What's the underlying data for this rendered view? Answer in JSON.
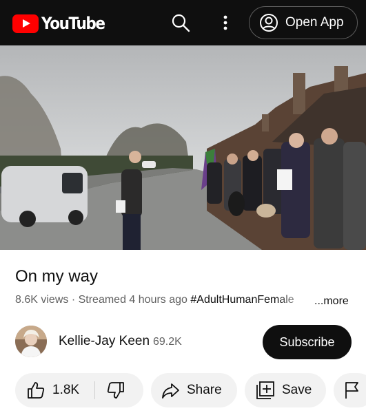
{
  "header": {
    "logo_text": "YouTube",
    "open_app_label": "Open App",
    "icons": [
      "youtube-logo",
      "search-icon",
      "more-vert-icon",
      "account-circle-icon"
    ]
  },
  "video": {
    "title": "On my way",
    "views": "8.6K views",
    "separator": "·",
    "streamed": "Streamed 4 hours ago",
    "hashtag": "#AdultHumanFemale",
    "more_label": "...more"
  },
  "channel": {
    "name": "Kellie-Jay Keen",
    "subscribers": "69.2K",
    "subscribe_label": "Subscribe"
  },
  "actions": {
    "like_count": "1.8K",
    "share_label": "Share",
    "save_label": "Save",
    "icons": [
      "thumb-up-icon",
      "thumb-down-icon",
      "share-arrow-icon",
      "playlist-add-icon",
      "flag-icon"
    ]
  },
  "colors": {
    "brand_red": "#ff0000",
    "header_bg": "#0f0f0f",
    "pill_bg": "#f2f2f2",
    "secondary_text": "#606060"
  }
}
